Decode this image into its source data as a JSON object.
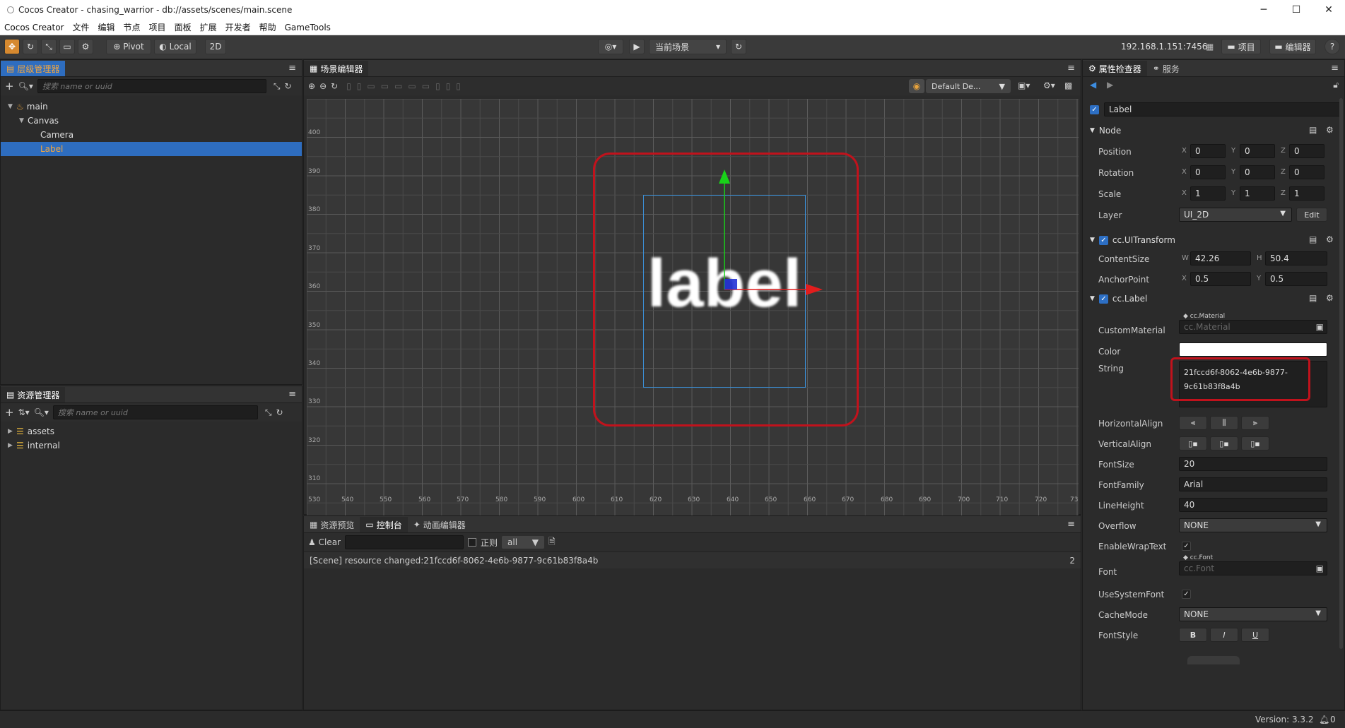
{
  "window": {
    "title": "Cocos Creator - chasing_warrior - db://assets/scenes/main.scene",
    "min": "─",
    "max": "☐",
    "close": "✕"
  },
  "menu": [
    "Cocos Creator",
    "文件",
    "编辑",
    "节点",
    "项目",
    "面板",
    "扩展",
    "开发者",
    "帮助",
    "GameTools"
  ],
  "toolbar": {
    "pivot": "Pivot",
    "local": "Local",
    "mode2d": "2D",
    "scene_select": "当前场景",
    "ip": "192.168.1.151:7456",
    "project": "项目",
    "editor": "编辑器"
  },
  "hierarchy": {
    "tab": "层级管理器",
    "search_placeholder": "搜索 name or uuid",
    "items": [
      {
        "label": "main"
      },
      {
        "label": "Canvas"
      },
      {
        "label": "Camera"
      },
      {
        "label": "Label"
      }
    ]
  },
  "assets": {
    "tab": "资源管理器",
    "search_placeholder": "搜索 name or uuid",
    "items": [
      {
        "label": "assets"
      },
      {
        "label": "internal"
      }
    ]
  },
  "scene": {
    "tab": "场景编辑器",
    "camera_select": "Default De...",
    "label_text": "label",
    "y_ticks": [
      "400",
      "390",
      "380",
      "370",
      "360",
      "350",
      "340",
      "330",
      "320",
      "310"
    ],
    "x_ticks": [
      "530",
      "540",
      "550",
      "560",
      "570",
      "580",
      "590",
      "600",
      "610",
      "620",
      "630",
      "640",
      "650",
      "660",
      "670",
      "680",
      "690",
      "700",
      "710",
      "720",
      "73"
    ]
  },
  "console": {
    "tabs": [
      "资源预览",
      "控制台",
      "动画编辑器"
    ],
    "clear": "Clear",
    "regex": "正则",
    "filter": "all",
    "log": "[Scene] resource changed:21fccd6f-8062-4e6b-9877-9c61b83f8a4b",
    "count": "2"
  },
  "inspector": {
    "tabs": [
      "属性检查器",
      "服务"
    ],
    "node_name": "Label",
    "node_section": "Node",
    "position": {
      "label": "Position",
      "x": "0",
      "y": "0",
      "z": "0"
    },
    "rotation": {
      "label": "Rotation",
      "x": "0",
      "y": "0",
      "z": "0"
    },
    "scale": {
      "label": "Scale",
      "x": "1",
      "y": "1",
      "z": "1"
    },
    "layer": {
      "label": "Layer",
      "value": "UI_2D",
      "edit": "Edit"
    },
    "uitransform": "cc.UITransform",
    "content_size": {
      "label": "ContentSize",
      "w": "42.26",
      "h": "50.4"
    },
    "anchor_point": {
      "label": "AnchorPoint",
      "x": "0.5",
      "y": "0.5"
    },
    "cclabel": "cc.Label",
    "custom_material": {
      "label": "CustomMaterial",
      "tag": "cc.Material",
      "value": "cc.Material"
    },
    "color": {
      "label": "Color",
      "value": "#ffffff"
    },
    "string": {
      "label": "String",
      "value": "21fccd6f-8062-4e6b-9877-9c61b83f8a4b",
      "line1": "21fccd6f-8062-4e6b-9877-",
      "line2": "9c61b83f8a4b"
    },
    "horizontal_align": "HorizontalAlign",
    "vertical_align": "VerticalAlign",
    "font_size": {
      "label": "FontSize",
      "value": "20"
    },
    "font_family": {
      "label": "FontFamily",
      "value": "Arial"
    },
    "line_height": {
      "label": "LineHeight",
      "value": "40"
    },
    "overflow": {
      "label": "Overflow",
      "value": "NONE"
    },
    "enable_wrap_text": "EnableWrapText",
    "font": {
      "label": "Font",
      "tag": "cc.Font",
      "value": "cc.Font"
    },
    "use_system_font": "UseSystemFont",
    "cache_mode": {
      "label": "CacheMode",
      "value": "NONE"
    },
    "font_style": {
      "label": "FontStyle",
      "bold": "B",
      "italic": "I",
      "underline": "U"
    }
  },
  "status": {
    "version": "Version: 3.3.2",
    "notifications": "0"
  },
  "colors": {
    "accent": "#2e6dbf",
    "highlight_red": "#c1121c",
    "tool_active": "#d6892f"
  }
}
